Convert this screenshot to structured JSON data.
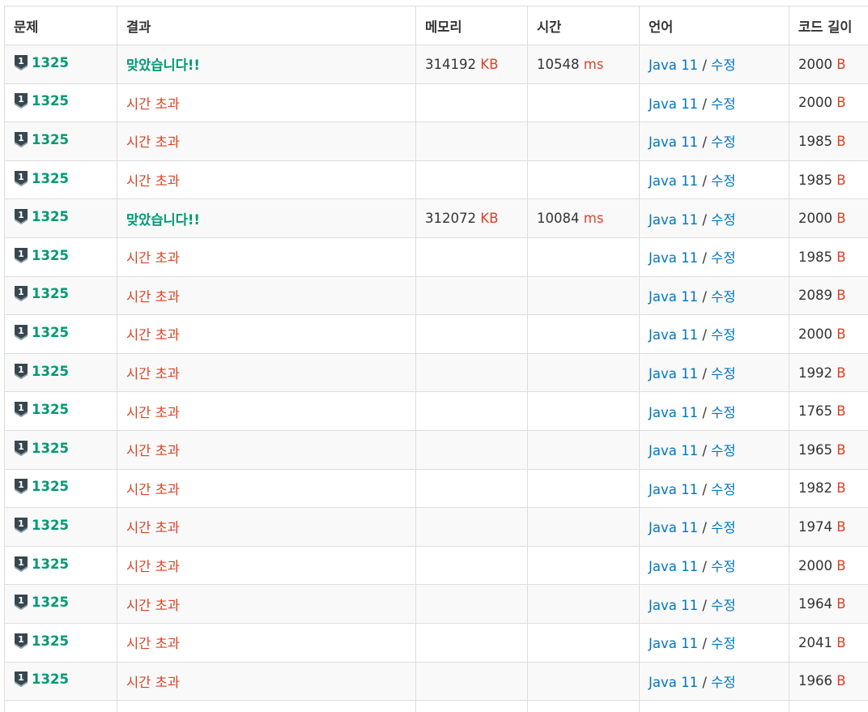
{
  "table": {
    "headers": [
      "문제",
      "결과",
      "메모리",
      "시간",
      "언어",
      "코드 길이"
    ],
    "tier_icon": "bronze-tier-1-icon",
    "colors": {
      "accepted": "#009874",
      "time_limit": "#dd4124",
      "link": "#0076c0",
      "unit": "#dd4124"
    },
    "rows": [
      {
        "problem": "1325",
        "tier": "1",
        "result": "맞았습니다!!",
        "accepted": true,
        "memory": "314192",
        "memory_unit": "KB",
        "time": "10548",
        "time_unit": "ms",
        "language": "Java 11",
        "separator": " / ",
        "edit": "수정",
        "code_length": "2000",
        "length_unit": "B"
      },
      {
        "problem": "1325",
        "tier": "1",
        "result": "시간 초과",
        "accepted": false,
        "memory": "",
        "memory_unit": "",
        "time": "",
        "time_unit": "",
        "language": "Java 11",
        "separator": " / ",
        "edit": "수정",
        "code_length": "2000",
        "length_unit": "B"
      },
      {
        "problem": "1325",
        "tier": "1",
        "result": "시간 초과",
        "accepted": false,
        "memory": "",
        "memory_unit": "",
        "time": "",
        "time_unit": "",
        "language": "Java 11",
        "separator": " / ",
        "edit": "수정",
        "code_length": "1985",
        "length_unit": "B"
      },
      {
        "problem": "1325",
        "tier": "1",
        "result": "시간 초과",
        "accepted": false,
        "memory": "",
        "memory_unit": "",
        "time": "",
        "time_unit": "",
        "language": "Java 11",
        "separator": " / ",
        "edit": "수정",
        "code_length": "1985",
        "length_unit": "B"
      },
      {
        "problem": "1325",
        "tier": "1",
        "result": "맞았습니다!!",
        "accepted": true,
        "memory": "312072",
        "memory_unit": "KB",
        "time": "10084",
        "time_unit": "ms",
        "language": "Java 11",
        "separator": " / ",
        "edit": "수정",
        "code_length": "2000",
        "length_unit": "B"
      },
      {
        "problem": "1325",
        "tier": "1",
        "result": "시간 초과",
        "accepted": false,
        "memory": "",
        "memory_unit": "",
        "time": "",
        "time_unit": "",
        "language": "Java 11",
        "separator": " / ",
        "edit": "수정",
        "code_length": "1985",
        "length_unit": "B"
      },
      {
        "problem": "1325",
        "tier": "1",
        "result": "시간 초과",
        "accepted": false,
        "memory": "",
        "memory_unit": "",
        "time": "",
        "time_unit": "",
        "language": "Java 11",
        "separator": " / ",
        "edit": "수정",
        "code_length": "2089",
        "length_unit": "B"
      },
      {
        "problem": "1325",
        "tier": "1",
        "result": "시간 초과",
        "accepted": false,
        "memory": "",
        "memory_unit": "",
        "time": "",
        "time_unit": "",
        "language": "Java 11",
        "separator": " / ",
        "edit": "수정",
        "code_length": "2000",
        "length_unit": "B"
      },
      {
        "problem": "1325",
        "tier": "1",
        "result": "시간 초과",
        "accepted": false,
        "memory": "",
        "memory_unit": "",
        "time": "",
        "time_unit": "",
        "language": "Java 11",
        "separator": " / ",
        "edit": "수정",
        "code_length": "1992",
        "length_unit": "B"
      },
      {
        "problem": "1325",
        "tier": "1",
        "result": "시간 초과",
        "accepted": false,
        "memory": "",
        "memory_unit": "",
        "time": "",
        "time_unit": "",
        "language": "Java 11",
        "separator": " / ",
        "edit": "수정",
        "code_length": "1765",
        "length_unit": "B"
      },
      {
        "problem": "1325",
        "tier": "1",
        "result": "시간 초과",
        "accepted": false,
        "memory": "",
        "memory_unit": "",
        "time": "",
        "time_unit": "",
        "language": "Java 11",
        "separator": " / ",
        "edit": "수정",
        "code_length": "1965",
        "length_unit": "B"
      },
      {
        "problem": "1325",
        "tier": "1",
        "result": "시간 초과",
        "accepted": false,
        "memory": "",
        "memory_unit": "",
        "time": "",
        "time_unit": "",
        "language": "Java 11",
        "separator": " / ",
        "edit": "수정",
        "code_length": "1982",
        "length_unit": "B"
      },
      {
        "problem": "1325",
        "tier": "1",
        "result": "시간 초과",
        "accepted": false,
        "memory": "",
        "memory_unit": "",
        "time": "",
        "time_unit": "",
        "language": "Java 11",
        "separator": " / ",
        "edit": "수정",
        "code_length": "1974",
        "length_unit": "B"
      },
      {
        "problem": "1325",
        "tier": "1",
        "result": "시간 초과",
        "accepted": false,
        "memory": "",
        "memory_unit": "",
        "time": "",
        "time_unit": "",
        "language": "Java 11",
        "separator": " / ",
        "edit": "수정",
        "code_length": "2000",
        "length_unit": "B"
      },
      {
        "problem": "1325",
        "tier": "1",
        "result": "시간 초과",
        "accepted": false,
        "memory": "",
        "memory_unit": "",
        "time": "",
        "time_unit": "",
        "language": "Java 11",
        "separator": " / ",
        "edit": "수정",
        "code_length": "1964",
        "length_unit": "B"
      },
      {
        "problem": "1325",
        "tier": "1",
        "result": "시간 초과",
        "accepted": false,
        "memory": "",
        "memory_unit": "",
        "time": "",
        "time_unit": "",
        "language": "Java 11",
        "separator": " / ",
        "edit": "수정",
        "code_length": "2041",
        "length_unit": "B"
      },
      {
        "problem": "1325",
        "tier": "1",
        "result": "시간 초과",
        "accepted": false,
        "memory": "",
        "memory_unit": "",
        "time": "",
        "time_unit": "",
        "language": "Java 11",
        "separator": " / ",
        "edit": "수정",
        "code_length": "1966",
        "length_unit": "B"
      },
      {
        "problem": "",
        "tier": "",
        "result": "",
        "accepted": false,
        "memory": "",
        "memory_unit": "",
        "time": "",
        "time_unit": "",
        "language": "",
        "separator": "",
        "edit": "",
        "code_length": "",
        "length_unit": ""
      }
    ]
  }
}
